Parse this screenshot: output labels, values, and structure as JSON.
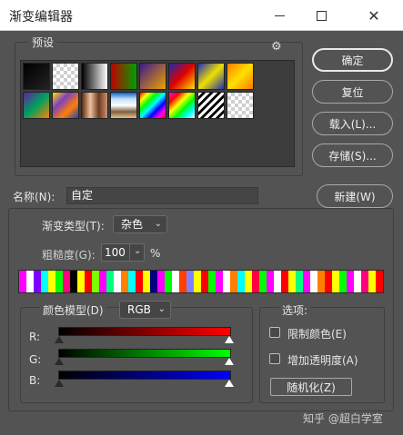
{
  "window": {
    "title": "渐变编辑器",
    "controls": {
      "minimize": "—",
      "maximize": "☐",
      "close": "✕"
    }
  },
  "presets": {
    "label": "预设",
    "gear_icon": "⚙",
    "swatches": [
      {
        "name": "foreground-to-background",
        "fill": "linear-gradient(135deg,#000 0%,#222 100%)"
      },
      {
        "name": "foreground-to-transparent",
        "fill": "checker"
      },
      {
        "name": "black-white",
        "fill": "linear-gradient(90deg,#000,#fff)"
      },
      {
        "name": "red-green",
        "fill": "linear-gradient(90deg,#c00000,#00a000)"
      },
      {
        "name": "violet-orange",
        "fill": "linear-gradient(135deg,#3a1a8a,#f0a000)"
      },
      {
        "name": "blue-red-yellow",
        "fill": "linear-gradient(135deg,#1a2aa8,#e00000,#ffe000)"
      },
      {
        "name": "blue-yellow-blue",
        "fill": "linear-gradient(135deg,#2030b0,#f0e000,#2030b0)"
      },
      {
        "name": "orange-yellow-orange",
        "fill": "linear-gradient(135deg,#ff7a00,#ffe000,#ff7a00)"
      },
      {
        "name": "violet-green-orange",
        "fill": "linear-gradient(135deg,#6020a0,#00a060,#ff8000)"
      },
      {
        "name": "yellow-violet-orange-blue",
        "fill": "linear-gradient(135deg,#ffe000,#8040c0,#ff8000,#2040c0)"
      },
      {
        "name": "copper",
        "fill": "linear-gradient(90deg,#5a2a10,#f0c0a0,#6a3a20,#d09070)"
      },
      {
        "name": "chrome",
        "fill": "linear-gradient(180deg,#1060c0,#c0e0ff,#ffffff,#806040,#e0c090)"
      },
      {
        "name": "spectrum",
        "fill": "linear-gradient(135deg,#f00,#ff0,#0f0,#0ff,#00f,#f0f,#f00)"
      },
      {
        "name": "transparent-rainbow",
        "fill": "linear-gradient(135deg,#f0f 0%,#f00 20%,#ff0 40%,#0f0 60%,#0ff 80%,#fff 100%)"
      },
      {
        "name": "transparent-stripes",
        "fill": "stripes"
      },
      {
        "name": "neutral-density",
        "fill": "checker"
      }
    ]
  },
  "buttons": {
    "ok": "确定",
    "reset": "复位",
    "load": "载入(L)...",
    "save": "存储(S)...",
    "new": "新建(W)",
    "randomize": "随机化(Z)"
  },
  "name_row": {
    "label": "名称(N):",
    "value": "自定"
  },
  "gradient": {
    "type_label": "渐变类型(T):",
    "type_value": "杂色",
    "roughness_label": "粗糙度(G):",
    "roughness_value": "100",
    "roughness_unit": "%",
    "noise_colors": [
      "#ff00ff",
      "#ffffff",
      "#8000ff",
      "#00ffff",
      "#ffff00",
      "#00ff00",
      "#ff0080",
      "#000000",
      "#ffff00",
      "#ff0000",
      "#80ff00",
      "#ff00ff",
      "#00ff80",
      "#ffffff",
      "#ff8000",
      "#00ffff",
      "#ff0000",
      "#ffff00",
      "#000080",
      "#ff00ff",
      "#00ff00",
      "#ffffff",
      "#ff4000",
      "#8080ff",
      "#ffff00",
      "#ff0000",
      "#00ff00",
      "#ff00ff",
      "#ffffff",
      "#ff8000",
      "#00ffff",
      "#ffff00",
      "#ff0040",
      "#00ff00",
      "#ff00ff",
      "#ffffff",
      "#ff0000",
      "#ffff00",
      "#00ff80",
      "#ff00ff",
      "#ffffff",
      "#ff8000",
      "#ff0000",
      "#ffff00",
      "#00ff00",
      "#ff00ff",
      "#ffffff",
      "#ff0080",
      "#ffff00",
      "#ff0000"
    ]
  },
  "color_model": {
    "label": "颜色模型(D)",
    "value": "RGB",
    "channels": [
      {
        "label": "R:",
        "from": "#000000",
        "to": "#ff0000"
      },
      {
        "label": "G:",
        "from": "#000000",
        "to": "#00ff00"
      },
      {
        "label": "B:",
        "from": "#000000",
        "to": "#0000ff"
      }
    ]
  },
  "options": {
    "label": "选项:",
    "restrict_colors": "限制颜色(E)",
    "add_transparency": "增加透明度(A)"
  },
  "watermark": "知乎 @超白学室"
}
